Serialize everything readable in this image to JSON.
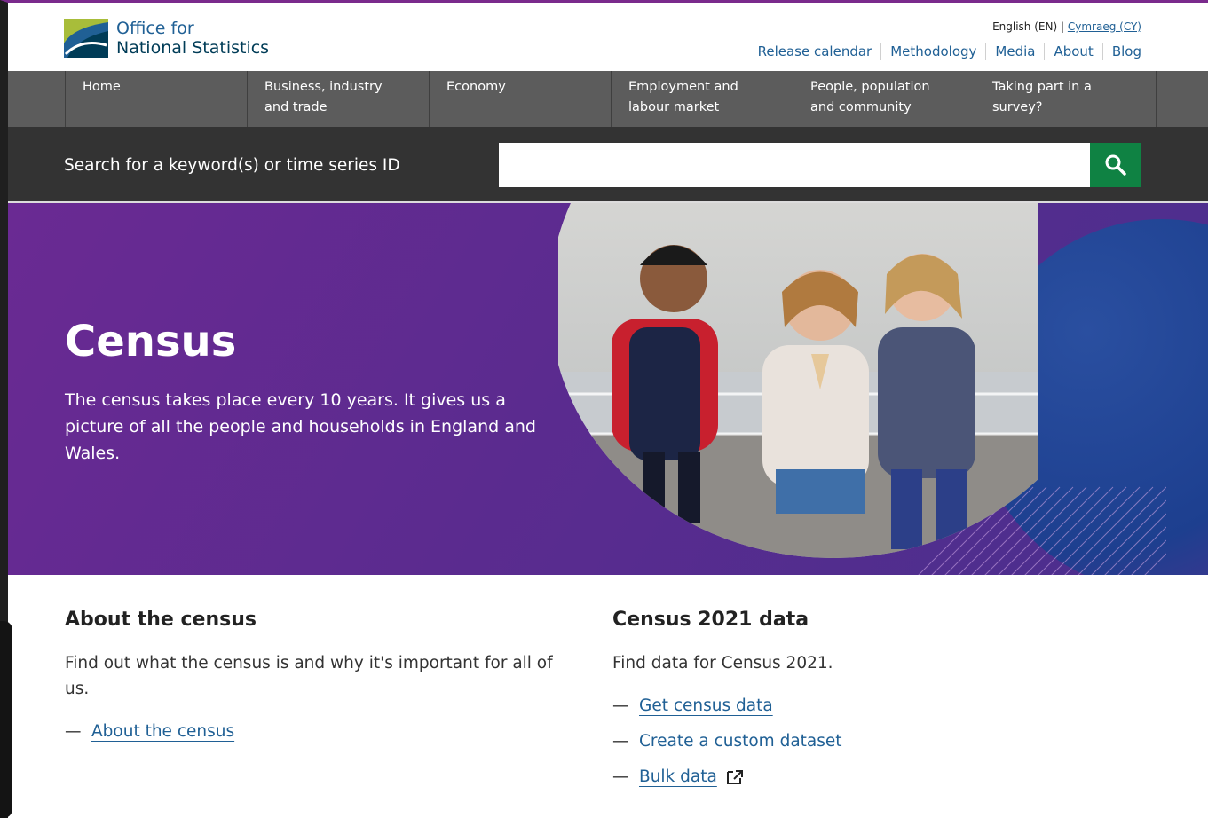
{
  "header": {
    "logo_line1": "Office for",
    "logo_line2": "National Statistics",
    "lang_current": "English (EN)",
    "lang_separator": "|",
    "lang_other": "Cymraeg (CY)",
    "utility_links": [
      "Release calendar",
      "Methodology",
      "Media",
      "About",
      "Blog"
    ]
  },
  "nav": {
    "items": [
      {
        "line1": "Home",
        "line2": ""
      },
      {
        "line1": "Business, industry",
        "line2": "and trade"
      },
      {
        "line1": "Economy",
        "line2": ""
      },
      {
        "line1": "Employment and",
        "line2": "labour market"
      },
      {
        "line1": "People, population",
        "line2": "and community"
      },
      {
        "line1": "Taking part in a",
        "line2": "survey?"
      }
    ]
  },
  "search": {
    "label": "Search for a keyword(s) or time series ID",
    "value": ""
  },
  "hero": {
    "title": "Census",
    "description": "The census takes place every 10 years. It gives us a picture of all the people and households in England and Wales."
  },
  "about": {
    "heading": "About the census",
    "text": "Find out what the census is and why it's important for all of us.",
    "links": [
      "About the census"
    ]
  },
  "data": {
    "heading": "Census 2021 data",
    "text": "Find data for Census 2021.",
    "links": [
      "Get census data",
      "Create a custom dataset",
      "Bulk data"
    ]
  },
  "colors": {
    "brand_blue": "#206095",
    "search_green": "#0f8243",
    "nav_gray": "#5c5c5c",
    "hero_purple": "#5b2b8f"
  }
}
